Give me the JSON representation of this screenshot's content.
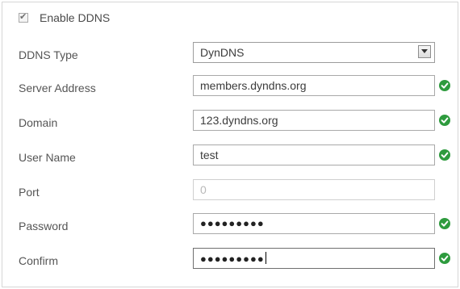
{
  "enable": {
    "label": "Enable DDNS",
    "checked": true
  },
  "form": {
    "ddns_type": {
      "label": "DDNS Type",
      "value": "DynDNS"
    },
    "server_address": {
      "label": "Server Address",
      "value": "members.dyndns.org"
    },
    "domain": {
      "label": "Domain",
      "value": "123.dyndns.org"
    },
    "user_name": {
      "label": "User Name",
      "value": "test"
    },
    "port": {
      "label": "Port",
      "value": "0"
    },
    "password": {
      "label": "Password",
      "value": "●●●●●●●●●"
    },
    "confirm": {
      "label": "Confirm",
      "value": "●●●●●●●●●"
    }
  },
  "icons": {
    "valid": "check-circle-icon",
    "dropdown": "chevron-down-icon"
  },
  "colors": {
    "valid": "#2e9b3e",
    "field_border": "#a9a9a9",
    "disabled_border": "#cfcfcf"
  }
}
